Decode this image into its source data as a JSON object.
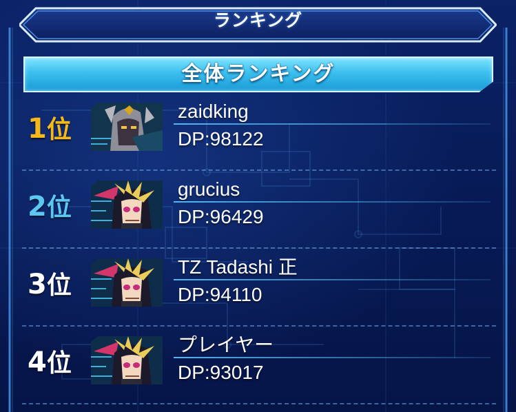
{
  "header": {
    "title": "ランキング"
  },
  "subheader": {
    "title": "全体ランキング"
  },
  "ranking": [
    {
      "rank": "1",
      "rank_suffix": "位",
      "name": "zaidking",
      "dp": "DP:98122",
      "rank_color": "#f5b91c",
      "avatar": "dark-character-portrait"
    },
    {
      "rank": "2",
      "rank_suffix": "位",
      "name": "grucius",
      "dp": "DP:96429",
      "rank_color": "#5cc8f2",
      "avatar": "yugi-portrait"
    },
    {
      "rank": "3",
      "rank_suffix": "位",
      "name": "TZ Tadashi 正",
      "dp": "DP:94110",
      "rank_color": "#ffffff",
      "avatar": "yugi-portrait"
    },
    {
      "rank": "4",
      "rank_suffix": "位",
      "name": "プレイヤー",
      "dp": "DP:93017",
      "rank_color": "#ffffff",
      "avatar": "yugi-portrait"
    }
  ],
  "colors": {
    "background": "#07164a",
    "accent": "#3cbfee",
    "gold": "#f5b91c",
    "silver_blue": "#5cc8f2"
  }
}
